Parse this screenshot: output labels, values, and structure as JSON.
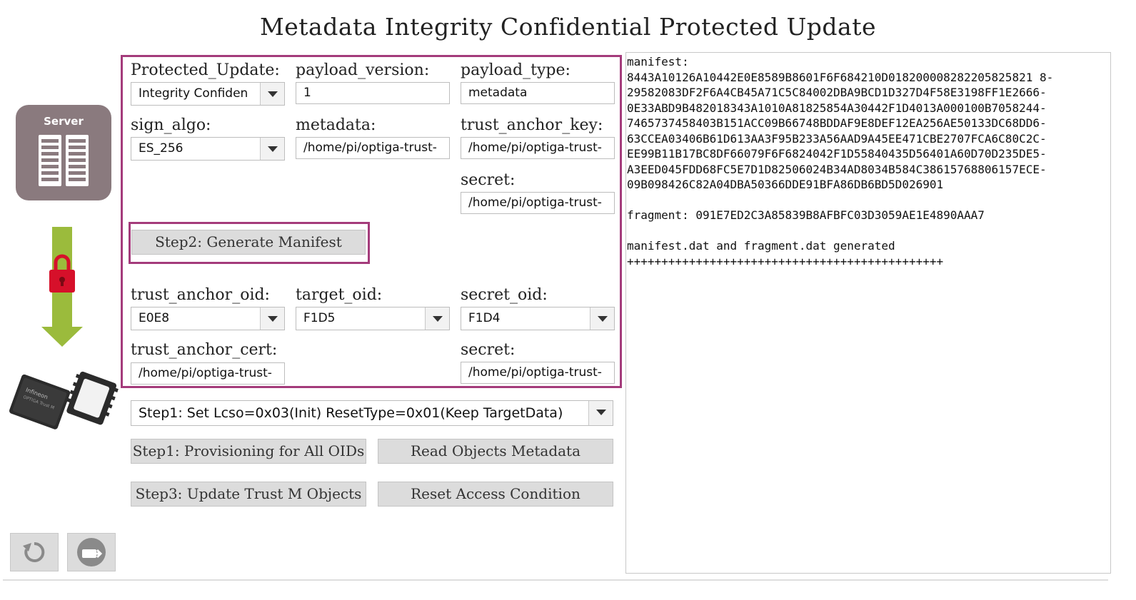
{
  "title": "Metadata Integrity Confidential Protected Update",
  "illustration": {
    "server_label": "Server",
    "server_icon": "server-icon",
    "lock_icon": "padlock-icon",
    "chip_icon": "chip-icon",
    "accent": "#a43b7b",
    "arrow_color": "#9bbb3c",
    "lock_color": "#d6102a"
  },
  "form": {
    "protected_update": {
      "label": "Protected_Update:",
      "value": "Integrity Confiden"
    },
    "payload_version": {
      "label": "payload_version:",
      "value": "1"
    },
    "payload_type": {
      "label": "payload_type:",
      "value": "metadata"
    },
    "sign_algo": {
      "label": "sign_algo:",
      "value": "ES_256"
    },
    "metadata": {
      "label": "metadata:",
      "value": "/home/pi/optiga-trust-"
    },
    "trust_anchor_key": {
      "label": "trust_anchor_key:",
      "value": "/home/pi/optiga-trust-"
    },
    "secret_top": {
      "label": "secret:",
      "value": "/home/pi/optiga-trust-"
    },
    "generate_manifest": "Step2: Generate Manifest",
    "trust_anchor_oid": {
      "label": "trust_anchor_oid:",
      "value": "E0E8"
    },
    "target_oid": {
      "label": "target_oid:",
      "value": "F1D5"
    },
    "secret_oid": {
      "label": "secret_oid:",
      "value": "F1D4"
    },
    "trust_anchor_cert": {
      "label": "trust_anchor_cert:",
      "value": "/home/pi/optiga-trust-"
    },
    "secret_bottom": {
      "label": "secret:",
      "value": "/home/pi/optiga-trust-"
    }
  },
  "controls": {
    "step1_select": "Step1: Set Lcso=0x03(Init) ResetType=0x01(Keep TargetData)",
    "provisioning": "Step1: Provisioning for All OIDs",
    "read_metadata": "Read Objects Metadata",
    "update_objects": "Step3: Update Trust M Objects",
    "reset_access": "Reset Access Condition",
    "back_icon": "back-arrow-icon",
    "exit_icon": "exit-icon"
  },
  "output_text": "manifest:\n8443A10126A10442E0E8589B8601F6F684210D018200008282205825821 8-\n29582083DF2F6A4CB45A71C5C84002DBA9BCD1D327D4F58E3198FF1E2666-\n0E33ABD9B482018343A1010A81825854A30442F1D4013A000100B7058244-\n7465737458403B151ACC09B66748BDDAF9E8DEF12EA256AE50133DC68DD6-\n63CCEA03406B61D613AA3F95B233A56AAD9A45EE471CBE2707FCA6C80C2C-\nEE99B11B17BC8DF66079F6F6824042F1D55840435D56401A60D70D235DE5-\nA3EED045FDD68FC5E7D1D82506024B34AD8034B584C38615768806157ECE-\n09B098426C82A04DBA50366DDE91BFA86DB6BD5D026901\n\nfragment: 091E7ED2C3A85839B8AFBFC03D3059AE1E4890AAA7\n\nmanifest.dat and fragment.dat generated\n++++++++++++++++++++++++++++++++++++++++++++++"
}
